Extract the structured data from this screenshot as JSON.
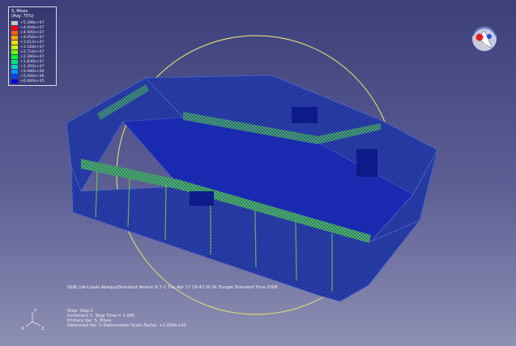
{
  "legend": {
    "title_1": "S, Mises",
    "title_2": "(Avg: 75%)",
    "rows": [
      {
        "value": "+5.388e+07",
        "color": "#c8c8c8"
      },
      {
        "value": "+4.944e+07",
        "color": "#ff0000"
      },
      {
        "value": "+4.500e+07",
        "color": "#ff5a00"
      },
      {
        "value": "+4.056e+07",
        "color": "#ffa500"
      },
      {
        "value": "+3.612e+07",
        "color": "#ffdd00"
      },
      {
        "value": "+3.168e+07",
        "color": "#c8ff00"
      },
      {
        "value": "+2.724e+07",
        "color": "#6eff00"
      },
      {
        "value": "+2.280e+07",
        "color": "#00ff20"
      },
      {
        "value": "+1.836e+07",
        "color": "#00e878"
      },
      {
        "value": "+1.392e+07",
        "color": "#00d2c8"
      },
      {
        "value": "+9.480e+06",
        "color": "#0096ff"
      },
      {
        "value": "+5.040e+06",
        "color": "#0046ff"
      },
      {
        "value": "+6.000e+05",
        "color": "#0000d8"
      }
    ]
  },
  "status": {
    "odb_line": "ODB: Job-Loads    Abaqus/Standard Version 6.7-1    Thu Apr 17 16:43:30 W. Europe Standard Time 2008",
    "step_line": "Step: Step-1",
    "increment_line": "Increment    1: Step Time =    1.000",
    "primary_var_line": "Primary Var: S, Mises",
    "deformed_line": "Deformed Var: U   Deformation Scale Factor: +1.000e+00"
  },
  "triad": {
    "x": "X",
    "y": "Y",
    "z": "Z"
  },
  "colors": {
    "background_top": "#3c3f7a",
    "background_bottom": "#8e90b4",
    "mesh_base": "#1b2c8c",
    "mesh_stress": "#3aa83a",
    "circle": "#d8d27a"
  },
  "icons": {
    "view_cube": "view-manipulator-icon",
    "triad": "axis-triad-icon"
  }
}
